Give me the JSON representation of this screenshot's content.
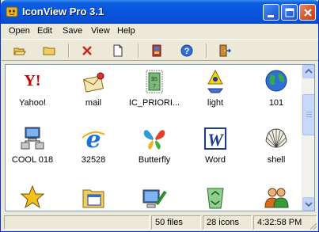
{
  "window": {
    "title": "IconView Pro 3.1"
  },
  "menu": {
    "items": [
      "Open",
      "Edit",
      "Save",
      "View",
      "Help"
    ]
  },
  "toolbar": {
    "buttons": [
      "open-folder-icon",
      "folder-icon",
      "delete-icon",
      "new-document-icon",
      "book-icon",
      "help-icon",
      "exit-door-icon"
    ]
  },
  "icons": [
    {
      "label": "Yahoo!",
      "icon": "yahoo-icon"
    },
    {
      "label": "mail",
      "icon": "mail-icon"
    },
    {
      "label": "IC_PRIORI...",
      "icon": "stamp-icon"
    },
    {
      "label": "light",
      "icon": "light-icon"
    },
    {
      "label": "101",
      "icon": "globe-icon"
    },
    {
      "label": "COOL 018",
      "icon": "network-computer-icon"
    },
    {
      "label": "32528",
      "icon": "internet-explorer-icon"
    },
    {
      "label": "Butterfly",
      "icon": "butterfly-icon"
    },
    {
      "label": "Word",
      "icon": "word-icon"
    },
    {
      "label": "shell",
      "icon": "shell-icon"
    },
    {
      "label": "",
      "icon": "star-icon"
    },
    {
      "label": "",
      "icon": "calendar-folder-icon"
    },
    {
      "label": "",
      "icon": "computer-tools-icon"
    },
    {
      "label": "",
      "icon": "recycle-bin-icon"
    },
    {
      "label": "",
      "icon": "users-icon"
    }
  ],
  "status": {
    "main": "",
    "files": "50 files",
    "icons": "28 icons",
    "time": "4:32:58 PM"
  },
  "colors": {
    "titlebar": "#0855dd",
    "close_button": "#d8542f",
    "face": "#ece9d8"
  }
}
